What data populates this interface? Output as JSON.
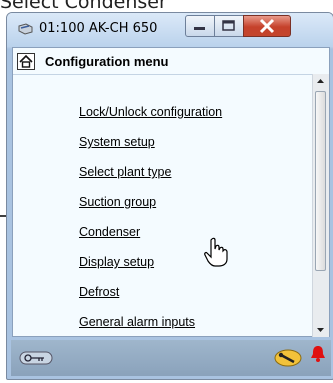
{
  "caption_text": "Select Condenser",
  "window": {
    "title": "01:100 AK-CH 650",
    "minimize_icon": "minimize-icon",
    "maximize_icon": "maximize-icon",
    "close_icon": "close-icon"
  },
  "header": {
    "title": "Configuration menu",
    "icon": "home-icon"
  },
  "menu": {
    "items": [
      {
        "label": "Lock/Unlock configuration"
      },
      {
        "label": "System setup"
      },
      {
        "label": "Select plant type"
      },
      {
        "label": "Suction group"
      },
      {
        "label": "Condenser"
      },
      {
        "label": "Display setup"
      },
      {
        "label": "Defrost"
      },
      {
        "label": "General alarm inputs"
      }
    ],
    "highlighted": "Condenser"
  },
  "bottom": {
    "left_icon": "key-icon",
    "right_icon": "wrench-icon",
    "alarm_icon": "alarm-bell-icon"
  },
  "colors": {
    "content_bg": "#f4fbff",
    "close_button": "#c5412b",
    "alarm": "#e01010"
  }
}
